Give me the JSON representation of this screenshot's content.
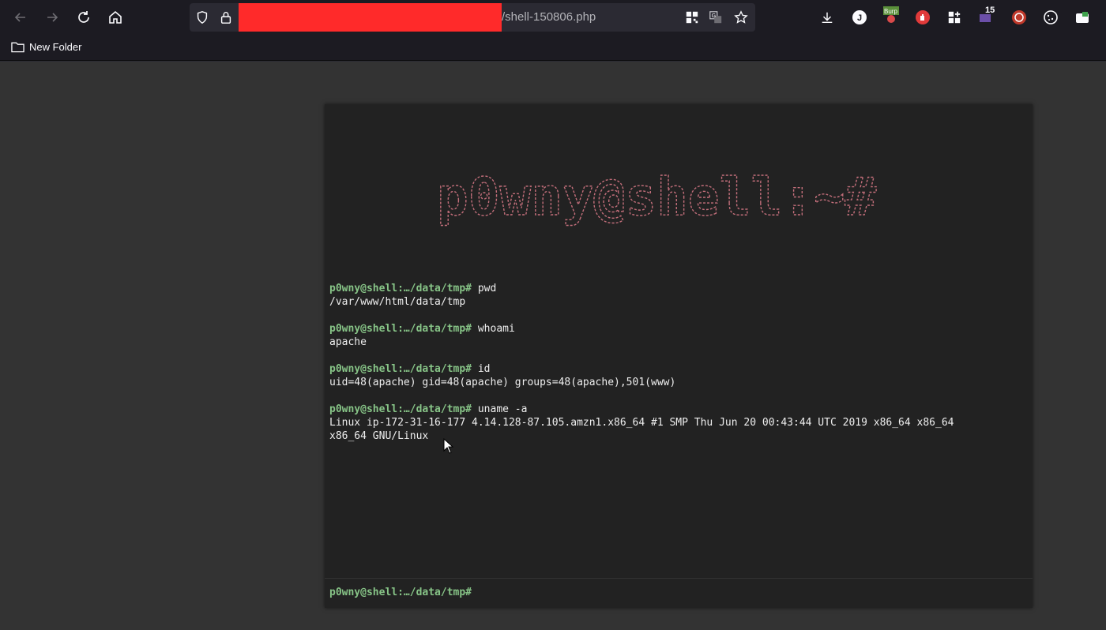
{
  "browser": {
    "url_suffix": "/shell-150806.php",
    "bookmark_folder": "New Folder",
    "extension_badge_count": "15",
    "extension_label_burp": "Burp",
    "profile_initial": "J"
  },
  "shell": {
    "banner_text": "p0wny@shell:~#",
    "banner_color": "#c26e7a",
    "prompt_color": "#87c487",
    "history": [
      {
        "prompt": "p0wny@shell:…/data/tmp#",
        "command": "pwd",
        "output": "/var/www/html/data/tmp"
      },
      {
        "prompt": "p0wny@shell:…/data/tmp#",
        "command": "whoami",
        "output": "apache"
      },
      {
        "prompt": "p0wny@shell:…/data/tmp#",
        "command": "id",
        "output": "uid=48(apache) gid=48(apache) groups=48(apache),501(www)"
      },
      {
        "prompt": "p0wny@shell:…/data/tmp#",
        "command": "uname -a",
        "output": "Linux ip-172-31-16-177 4.14.128-87.105.amzn1.x86_64 #1 SMP Thu Jun 20 00:43:44 UTC 2019 x86_64 x86_64\nx86_64 GNU/Linux"
      }
    ],
    "current_prompt": "p0wny@shell:…/data/tmp#",
    "current_input": ""
  }
}
